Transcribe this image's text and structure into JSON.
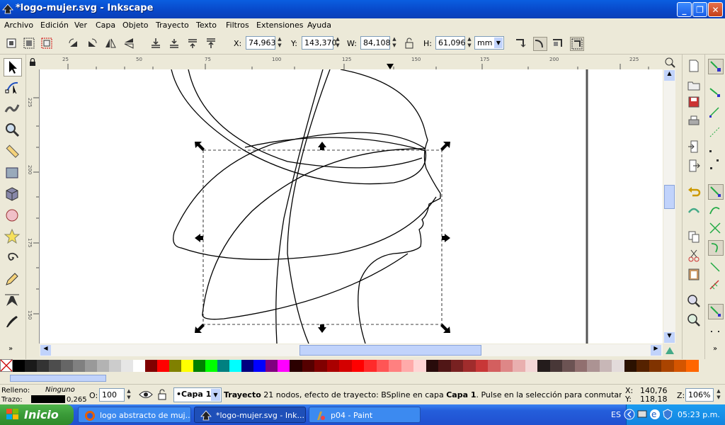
{
  "window": {
    "title": "*logo-mujer.svg - Inkscape"
  },
  "menu": [
    "Archivo",
    "Edición",
    "Ver",
    "Capa",
    "Objeto",
    "Trayecto",
    "Texto",
    "Filtros",
    "Extensiones",
    "Ayuda"
  ],
  "toolbar": {
    "x_label": "X:",
    "x_value": "74,963",
    "y_label": "Y:",
    "y_value": "143,370",
    "w_label": "W:",
    "w_value": "84,108",
    "h_label": "H:",
    "h_value": "61,096",
    "unit": "mm"
  },
  "ruler": {
    "h_ticks": [
      "25",
      "50",
      "75",
      "100",
      "125",
      "150",
      "175",
      "200",
      "225"
    ],
    "v_ticks": [
      "225",
      "200",
      "175",
      "150"
    ]
  },
  "palette": {
    "colors": [
      "#000000",
      "#1a1a1a",
      "#333333",
      "#4d4d4d",
      "#666666",
      "#808080",
      "#999999",
      "#b3b3b3",
      "#cccccc",
      "#e6e6e6",
      "#ffffff",
      "#800000",
      "#ff0000",
      "#808000",
      "#ffff00",
      "#008000",
      "#00ff00",
      "#008080",
      "#00ffff",
      "#000080",
      "#0000ff",
      "#800080",
      "#ff00ff",
      "#2b0000",
      "#550000",
      "#800000",
      "#aa0000",
      "#d40000",
      "#ff0000",
      "#ff2a2a",
      "#ff5555",
      "#ff8080",
      "#ffaaaa",
      "#ffd5d5",
      "#280b0b",
      "#501616",
      "#782121",
      "#a02c2c",
      "#c83737",
      "#d35f5f",
      "#de8787",
      "#e9afaf",
      "#f4d7d7",
      "#241c1c",
      "#483737",
      "#6c5353",
      "#916f6f",
      "#ac9393",
      "#c8b7b7",
      "#e3dbdb",
      "#2b1100",
      "#552200",
      "#803300",
      "#aa4400",
      "#d45500",
      "#ff6600"
    ]
  },
  "status": {
    "fill_label": "Relleno:",
    "fill_value": "Ninguno",
    "stroke_label": "Trazo:",
    "stroke_width": "0,265",
    "opacity_label": "O:",
    "opacity_value": "100",
    "layer": "•Capa 1",
    "message_bold": "Trayecto",
    "message_text": " 21 nodos, efecto de trayecto: BSpline en capa ",
    "message_layer": "Capa 1",
    "message_tail": ". Pulse en la selección para conmutar los tiradore…",
    "cursor_x_label": "X:",
    "cursor_x": "140,76",
    "cursor_y_label": "Y:",
    "cursor_y": "118,18",
    "zoom_label": "Z:",
    "zoom_value": "106%"
  },
  "taskbar": {
    "start": "Inicio",
    "tasks": [
      "logo abstracto de muj...",
      "*logo-mujer.svg - Ink...",
      "p04 - Paint"
    ],
    "lang": "ES",
    "time": "05:23 p.m."
  },
  "colors": {
    "title_blue": "#0a5ee0",
    "taskbar_blue": "#245edb",
    "start_green": "#3a9a38"
  }
}
